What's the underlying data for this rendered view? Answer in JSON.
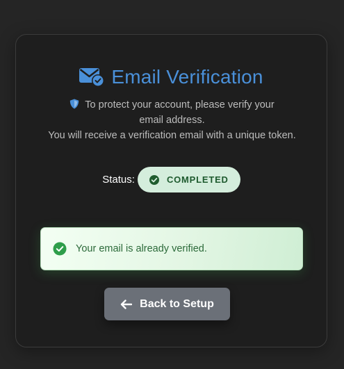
{
  "card": {
    "title": "Email Verification",
    "title_icon": "envelope-check-icon",
    "info_icon": "shield-icon",
    "info_line1": "To protect your account, please verify your email address.",
    "info_line2": "You will receive a verification email with a unique token."
  },
  "status": {
    "label": "Status:",
    "badge_icon": "check-circle-icon",
    "value": "COMPLETED"
  },
  "alert": {
    "icon": "check-circle-icon",
    "message": "Your email is already verified."
  },
  "actions": {
    "back_icon": "arrow-left-icon",
    "back_label": "Back to Setup"
  },
  "colors": {
    "accent": "#4a90d9",
    "success_badge_bg": "#d4eddc",
    "success_text": "#2c6a3a",
    "success_icon": "#2e9e4a",
    "button_bg": "#6b7078"
  }
}
